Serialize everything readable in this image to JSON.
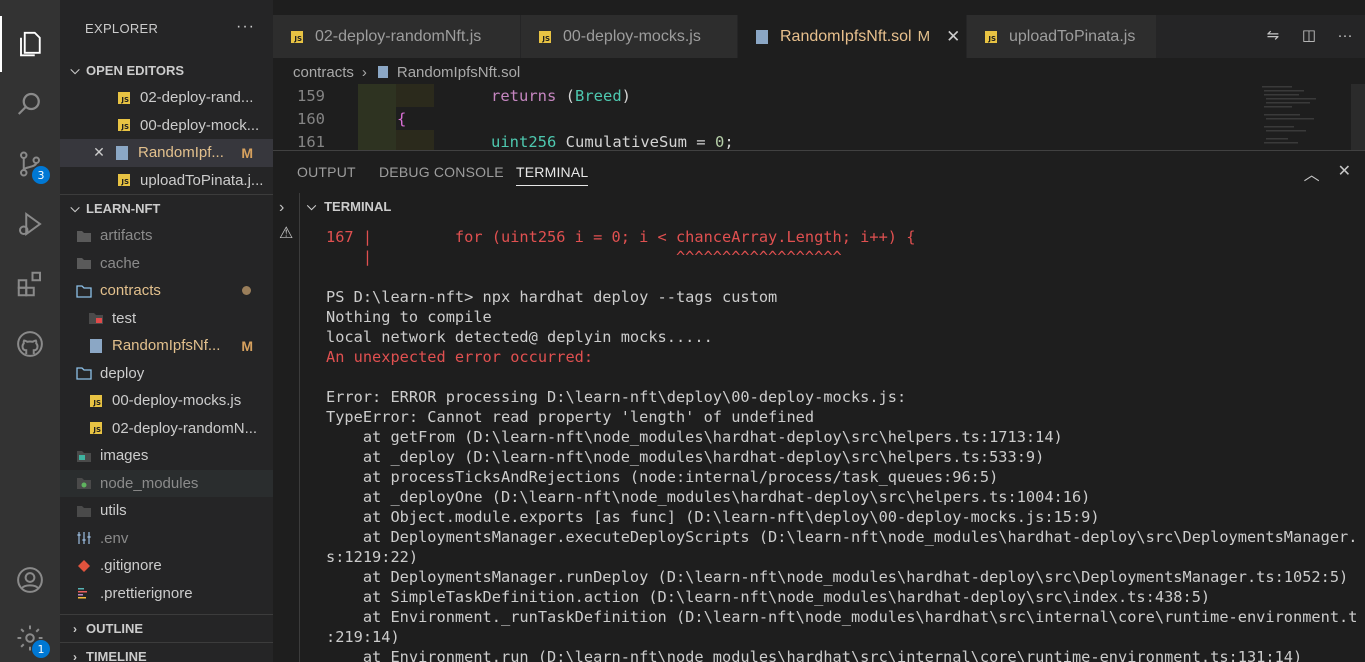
{
  "activity_bar": {
    "items": [
      {
        "name": "explorer-icon"
      },
      {
        "name": "search-icon"
      },
      {
        "name": "source-control-icon",
        "badge": "3"
      },
      {
        "name": "run-debug-icon"
      },
      {
        "name": "extensions-icon"
      },
      {
        "name": "github-icon"
      }
    ],
    "bottom": [
      {
        "name": "account-icon"
      },
      {
        "name": "settings-gear-icon",
        "badge": "1"
      }
    ]
  },
  "sidebar": {
    "title": "EXPLORER",
    "more": "···",
    "open_editors": {
      "label": "OPEN EDITORS",
      "items": [
        {
          "label": "02-deploy-rand...",
          "type": "js"
        },
        {
          "label": "00-deploy-mock...",
          "type": "js"
        },
        {
          "label": "RandomIpf...",
          "type": "sol",
          "status": "M"
        },
        {
          "label": "uploadToPinata.j...",
          "type": "js"
        }
      ]
    },
    "workspace": {
      "label": "LEARN-NFT",
      "items": [
        {
          "label": "artifacts"
        },
        {
          "label": "cache"
        },
        {
          "label": "contracts"
        },
        {
          "label": "test"
        },
        {
          "label": "RandomIpfsNf...",
          "status": "M"
        },
        {
          "label": "deploy"
        },
        {
          "label": "00-deploy-mocks.js"
        },
        {
          "label": "02-deploy-randomN..."
        },
        {
          "label": "images"
        },
        {
          "label": "node_modules"
        },
        {
          "label": "utils"
        },
        {
          "label": ".env"
        },
        {
          "label": ".gitignore"
        },
        {
          "label": ".prettierignore"
        }
      ]
    },
    "outline": "OUTLINE",
    "timeline": "TIMELINE"
  },
  "tabs": [
    {
      "label": "02-deploy-randomNft.js"
    },
    {
      "label": "00-deploy-mocks.js"
    },
    {
      "label": "RandomIpfsNft.sol",
      "status": "M",
      "close": "✕"
    },
    {
      "label": "uploadToPinata.js"
    }
  ],
  "breadcrumb": {
    "folder": "contracts",
    "file": "RandomIpfsNft.sol"
  },
  "editor": {
    "lines": [
      {
        "num": "159",
        "kw": "returns",
        "rest": " (",
        "type": "Breed",
        "end": ")"
      },
      {
        "num": "160",
        "brace": "{"
      },
      {
        "num": "161",
        "type": "uint256",
        "rest": " CumulativeSum = ",
        "number": "0",
        "end": ";"
      }
    ]
  },
  "panel": {
    "tabs": [
      "OUTPUT",
      "DEBUG CONSOLE",
      "TERMINAL"
    ],
    "active_tab": "TERMINAL",
    "terminal_header": "TERMINAL",
    "terminal_lines": [
      {
        "text": "167 |         for (uint256 i = 0; i < chanceArray.Length; i++) {",
        "style": "red"
      },
      {
        "text": "    |                                 ^^^^^^^^^^^^^^^^^^",
        "style": "red"
      },
      {
        "text": "",
        "style": ""
      },
      {
        "text": "PS D:\\learn-nft> npx hardhat deploy --tags custom",
        "style": ""
      },
      {
        "text": "Nothing to compile",
        "style": ""
      },
      {
        "text": "local network detected@ deplyin mocks.....",
        "style": ""
      },
      {
        "text": "An unexpected error occurred:",
        "style": "red"
      },
      {
        "text": "",
        "style": ""
      },
      {
        "text": "Error: ERROR processing D:\\learn-nft\\deploy\\00-deploy-mocks.js:",
        "style": ""
      },
      {
        "text": "TypeError: Cannot read property 'length' of undefined",
        "style": ""
      },
      {
        "text": "    at getFrom (D:\\learn-nft\\node_modules\\hardhat-deploy\\src\\helpers.ts:1713:14)",
        "style": ""
      },
      {
        "text": "    at _deploy (D:\\learn-nft\\node_modules\\hardhat-deploy\\src\\helpers.ts:533:9)",
        "style": ""
      },
      {
        "text": "    at processTicksAndRejections (node:internal/process/task_queues:96:5)",
        "style": ""
      },
      {
        "text": "    at _deployOne (D:\\learn-nft\\node_modules\\hardhat-deploy\\src\\helpers.ts:1004:16)",
        "style": ""
      },
      {
        "text": "    at Object.module.exports [as func] (D:\\learn-nft\\deploy\\00-deploy-mocks.js:15:9)",
        "style": ""
      },
      {
        "text": "    at DeploymentsManager.executeDeployScripts (D:\\learn-nft\\node_modules\\hardhat-deploy\\src\\DeploymentsManager.",
        "style": ""
      },
      {
        "text": "s:1219:22)",
        "style": ""
      },
      {
        "text": "    at DeploymentsManager.runDeploy (D:\\learn-nft\\node_modules\\hardhat-deploy\\src\\DeploymentsManager.ts:1052:5)",
        "style": ""
      },
      {
        "text": "    at SimpleTaskDefinition.action (D:\\learn-nft\\node_modules\\hardhat-deploy\\src\\index.ts:438:5)",
        "style": ""
      },
      {
        "text": "    at Environment._runTaskDefinition (D:\\learn-nft\\node_modules\\hardhat\\src\\internal\\core\\runtime-environment.t",
        "style": ""
      },
      {
        "text": ":219:14)",
        "style": ""
      },
      {
        "text": "    at Environment.run (D:\\learn-nft\\node_modules\\hardhat\\src\\internal\\core\\runtime-environment.ts:131:14)",
        "style": ""
      }
    ]
  },
  "colors": {
    "accent": "#0078d4",
    "modified": "#e2c08d",
    "error": "#f14c4c",
    "js_icon": "#e8c343"
  }
}
